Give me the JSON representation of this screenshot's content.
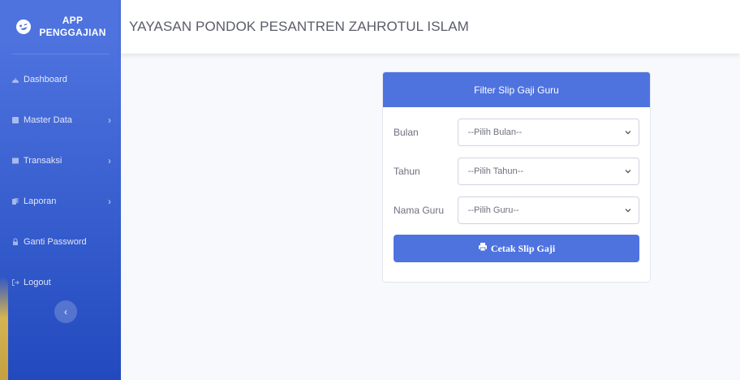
{
  "brand": {
    "line1": "APP",
    "line2": "PENGGAJIAN"
  },
  "sidebar": {
    "items": [
      {
        "label": "Dashboard",
        "icon": "dashboard-icon",
        "has_chevron": false
      },
      {
        "label": "Master Data",
        "icon": "database-icon",
        "has_chevron": true
      },
      {
        "label": "Transaksi",
        "icon": "table-icon",
        "has_chevron": true
      },
      {
        "label": "Laporan",
        "icon": "copy-icon",
        "has_chevron": true
      },
      {
        "label": "Ganti Password",
        "icon": "lock-icon",
        "has_chevron": false
      },
      {
        "label": "Logout",
        "icon": "sign-out-icon",
        "has_chevron": false
      }
    ],
    "chevron": "›",
    "toggle": "‹"
  },
  "topbar": {
    "title": "YAYASAN PONDOK PESANTREN ZAHROTUL ISLAM"
  },
  "card": {
    "title": "Filter Slip Gaji Guru",
    "fields": [
      {
        "label": "Bulan",
        "value": "--Pilih Bulan--"
      },
      {
        "label": "Tahun",
        "value": "--Pilih Tahun--"
      },
      {
        "label": "Nama Guru",
        "value": "--Pilih Guru--"
      }
    ],
    "button": "Cetak Slip Gaji"
  },
  "colors": {
    "primary": "#4e73df",
    "sidebar_dark": "#224abe",
    "background": "#f8f9fc"
  }
}
